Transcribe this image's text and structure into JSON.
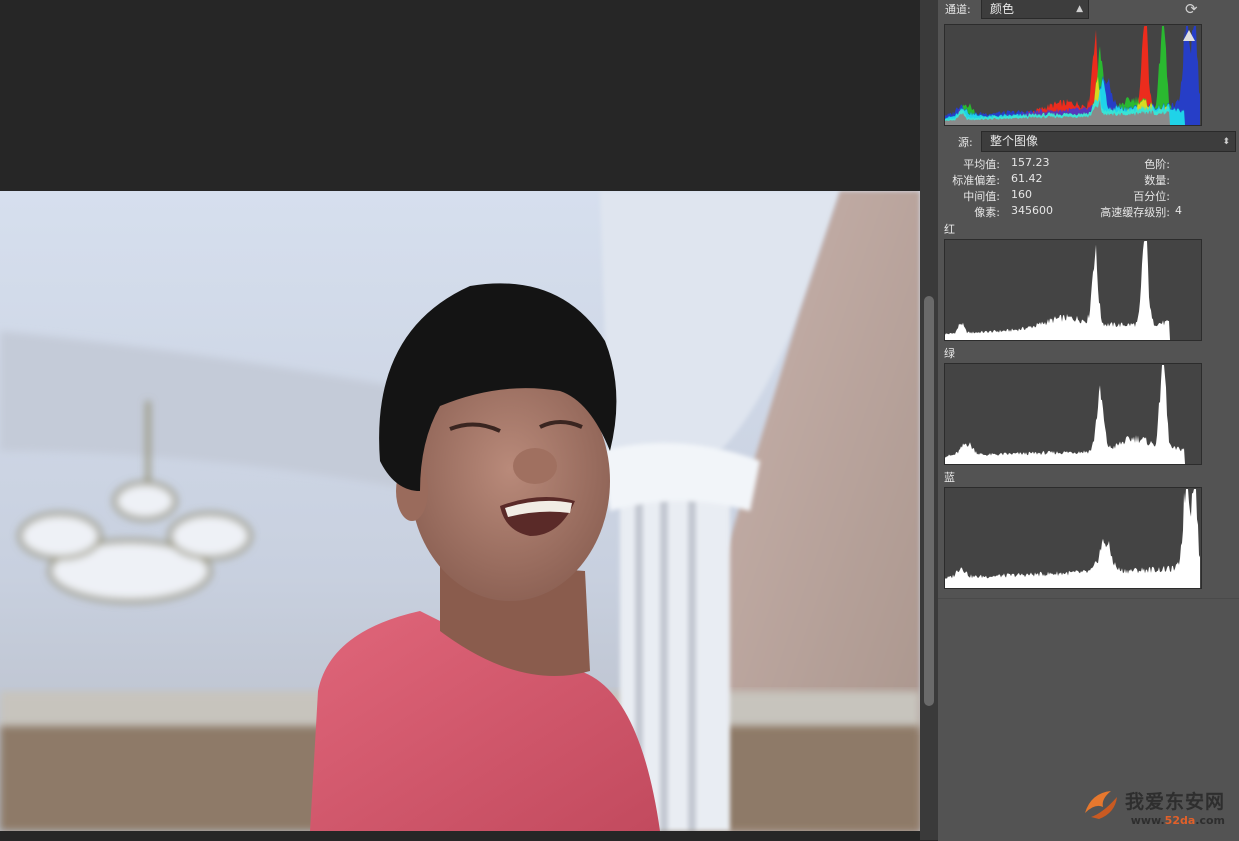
{
  "histogram_panel": {
    "channel_label": "通道:",
    "channel_value": "颜色",
    "source_label": "源:",
    "source_value": "整个图像",
    "stats_left": [
      {
        "label": "平均值:",
        "value": "157.23"
      },
      {
        "label": "标准偏差:",
        "value": "61.42"
      },
      {
        "label": "中间值:",
        "value": "160"
      },
      {
        "label": "像素:",
        "value": "345600"
      }
    ],
    "stats_right": [
      {
        "label": "色阶:",
        "value": ""
      },
      {
        "label": "数量:",
        "value": ""
      },
      {
        "label": "百分位:",
        "value": ""
      },
      {
        "label": "高速缓存级别:",
        "value": "4"
      }
    ],
    "channels": [
      {
        "name": "红"
      },
      {
        "name": "绿"
      },
      {
        "name": "蓝"
      }
    ]
  },
  "watermark": {
    "title": "我爱东安网",
    "url_prefix": "www.",
    "url_accent": "52da",
    "url_suffix": ".com"
  },
  "icons": {
    "refresh": "refresh-icon",
    "warning": "warning-icon"
  }
}
